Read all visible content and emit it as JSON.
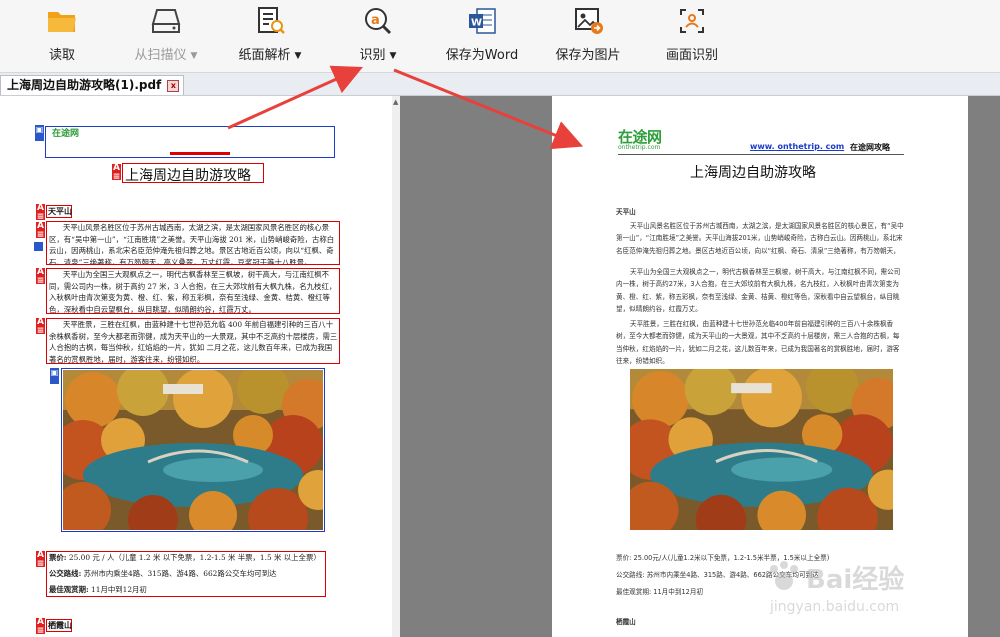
{
  "toolbar": {
    "read_label": "读取",
    "scanner_label": "从扫描仪",
    "layout_label": "纸面解析",
    "recognize_label": "识别",
    "save_word_label": "保存为Word",
    "save_image_label": "保存为图片",
    "area_recognize_label": "画面识别",
    "caret": "▼"
  },
  "tab": {
    "filename": "上海周边自助游攻略(1).pdf",
    "close": "x"
  },
  "left_page": {
    "logo_text": "在途网",
    "title": "上海周边自助游攻略",
    "section1": "天平山",
    "para1": "天平山风景名胜区位于苏州古城西南，太湖之滨，是太湖国家风景名胜区的核心景区，有“吴中第一山”，“江南胜境”之美誉。天平山海拔 201 米，山势峭峻奇险，古称白云山，因两桃山，系北宋名臣范仲淹先祖归葬之地。景区古地近百公顷，向以“红枫、奇石、清泉”三绝著称，有万笏朝天，高义叠翠，万丈红霞，豆浆冠于等十八胜景。",
    "para2": "天平山为全国三大观枫点之一，明代古枫香林至三枫坡，树干高大，与江南红枫不同，需公司内一株，树于高约 27 米，3 人合抱，在三大郊坟前有大枫九株，名九枝红，入秋枫叶由青次第变为黄、橙、红、紫，称五彩枫，奈有至浅绿、金黄、桔黄、橙红等色，深秋看中自云望枫台，纵目眺望，似晴朗约谷，红霞万丈。",
    "para3": "天平胜景，三胜在红枫，由蓝种建十七世孙范允临 400 年前自福建引种的三百八十余株枫香树，至今大都老而弥健，成为天平山的一大景观，其中不乏高约十层楼房，需三人合抱的古枫，每当仲秋，红焰焰的一片，犹如 二月之花，这儿数百年来，已成为我国著名的赏枫胜地，届时，游客往来，纷错如织。",
    "ticket_label": "票价:",
    "ticket_value": "25.00 元 / 人（儿童 1.2 米 以下免票，1.2-1.5 米 半票，1.5 米 以上全票）",
    "bus_label": "公交路线:",
    "bus_value": "苏州市内乘坐4路、315路、游4路、662路公交车均可到达",
    "season_label": "最佳观赏期:",
    "season_value": "11月中到12月初",
    "section2": "栖霞山"
  },
  "right_page": {
    "logo_text": "在途网",
    "logo_sub": "onthetrip.com",
    "site_url": "www. onthetrip. com",
    "site_name": "在途网攻略",
    "title": "上海周边自助游攻略",
    "section1": "天平山",
    "para1": "天平山风景名胜区位于苏州古城西南，太湖之滨，是太湖国家风景名胜区的核心景区，有“吴中第一山”，“江南胜境”之美誉。天平山海拔201米，山势峭峻奇险，古称白云山。因两桃山，系北宋名臣范仲淹先祖归葬之地。景区古地近百公顷，向以“红枫、奇石、清泉”三绝著称，有万笏朝天，高义叠翠，万丈红霞，豆浆冠于等十八胜景。",
    "para2": "天平山为全国三大观枫点之一，明代古枫香林至三枫坡，树干高大，与江南红枫不同，需公司内一株，树于高约27米，3人合抱，在三大郊坟前有大枫九株，名九枝红，入秋枫叶由青次第变为黄、橙、红、紫，称五彩枫，奈有至浅绿、金黄、桔黄、橙红等色，深秋看中自云望枫台，纵目眺望，似晴朗约谷，红霞万丈。",
    "para3": "天平胜景，三胜在红枫，由蓝种建十七世孙范允临400年前自福建引种的三百八十余株枫香树，至今大都老而弥健，成为天平山的一大景观，其中不乏高约十层楼房，需三人合抱的古枫，每当仲秋，红焰焰的一片，犹如二月之花，这儿数百年来，已成为我国著名的赏枫胜地，届时，游客往来，纷错如织。",
    "ticket_line": "票价:      25.00元/人(儿童1.2米以下免票，1.2-1.5米半票，1.5米以上全票)",
    "bus_line": "公交路线:    苏州市内乘坐4路、315路、游4路、662路公交车均可到达",
    "season_line": "最佳观赏期:   11月中到12月初",
    "section2": "栖霞山"
  },
  "watermark": {
    "text": "Bai经验",
    "url": "jingyan.baidu.com"
  },
  "colors": {
    "toolbar_bg": "#f6f6f6",
    "ocr_red": "#dd0000",
    "ocr_blue": "#1a3cc8",
    "arrow": "#e8403a",
    "logo_green": "#2e9d3a",
    "gutter_gray": "#7f7f7f"
  }
}
